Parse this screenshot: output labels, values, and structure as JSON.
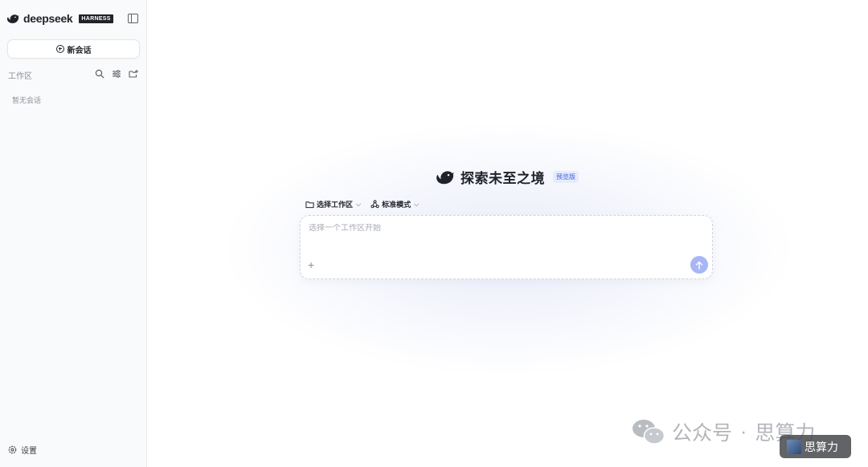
{
  "sidebar": {
    "logo_text": "deepseek",
    "logo_badge": "HARNESS",
    "new_chat_label": "新会话",
    "workspace_label": "工作区",
    "empty_text": "暂无会话",
    "settings_label": "设置"
  },
  "main": {
    "hero_title": "探索未至之境",
    "preview_badge": "预览版",
    "workspace_select_label": "选择工作区",
    "mode_select_label": "标准模式",
    "composer_placeholder": "选择一个工作区开始"
  },
  "watermark": {
    "text": "公众号",
    "dot": "·",
    "name": "思算力",
    "badge_text": "思算力"
  },
  "colors": {
    "accent": "#a8b6f5",
    "sidebar_bg": "#f9fafb",
    "preview_badge_bg": "#e6ecfb"
  }
}
